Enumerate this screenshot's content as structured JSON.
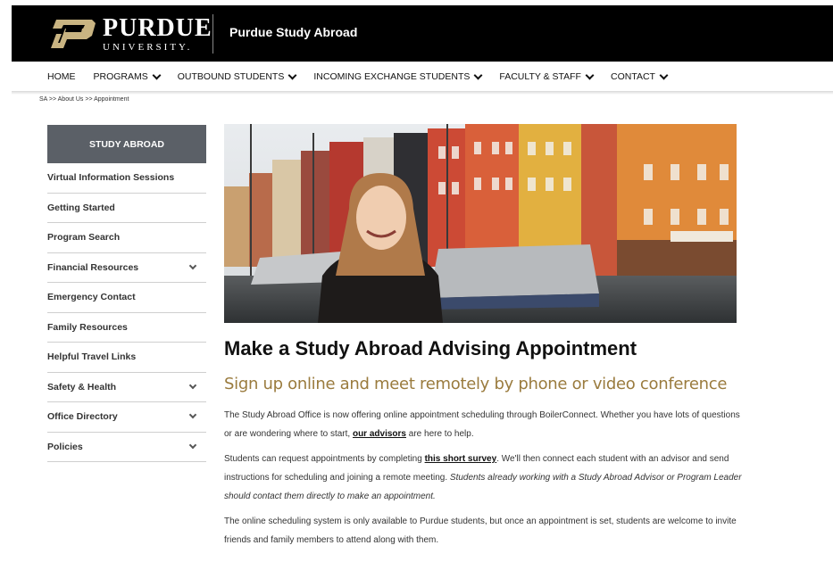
{
  "header": {
    "logo_word": "PURDUE",
    "logo_sub": "UNIVERSITY.",
    "site_title": "Purdue Study Abroad"
  },
  "nav": {
    "items": [
      {
        "label": "HOME",
        "dropdown": false
      },
      {
        "label": "PROGRAMS",
        "dropdown": true
      },
      {
        "label": "OUTBOUND STUDENTS",
        "dropdown": true
      },
      {
        "label": "INCOMING EXCHANGE STUDENTS",
        "dropdown": true
      },
      {
        "label": "FACULTY & STAFF",
        "dropdown": true
      },
      {
        "label": "CONTACT",
        "dropdown": true
      }
    ]
  },
  "breadcrumb": "SA >> About Us >> Appointment",
  "sidebar": {
    "header": "STUDY ABROAD",
    "items": [
      {
        "label": "Virtual Information Sessions",
        "expandable": false
      },
      {
        "label": "Getting Started",
        "expandable": false
      },
      {
        "label": "Program Search",
        "expandable": false
      },
      {
        "label": "Financial Resources",
        "expandable": true
      },
      {
        "label": "Emergency Contact",
        "expandable": false
      },
      {
        "label": "Family Resources",
        "expandable": false
      },
      {
        "label": "Helpful Travel Links",
        "expandable": false
      },
      {
        "label": "Safety & Health",
        "expandable": true
      },
      {
        "label": "Office Directory",
        "expandable": true
      },
      {
        "label": "Policies",
        "expandable": true
      }
    ]
  },
  "main": {
    "title": "Make a Study Abroad Advising Appointment",
    "subtitle": "Sign up online and meet remotely by phone or video conference",
    "p1_a": "The Study Abroad Office is now offering online appointment scheduling through BoilerConnect.  Whether you have lots of questions or are wondering where to start, ",
    "p1_link": "our advisors",
    "p1_b": " are here to help.",
    "p2_a": "Students can request appointments by completing ",
    "p2_link": "this short survey",
    "p2_b": ".  We'll then connect each student with an advisor and send instructions for scheduling and joining a remote meeting. ",
    "p2_italic": "Students already working with a Study Abroad Advisor or Program Leader should contact them directly to make an appointment.",
    "p3": "The online scheduling system is only available to Purdue students, but once an appointment is set, students are welcome to invite friends and family members to attend along with them."
  },
  "colors": {
    "black_bar": "#000000",
    "sidebar_header": "#5b6067",
    "gold_subtitle": "#9a7b3e"
  }
}
